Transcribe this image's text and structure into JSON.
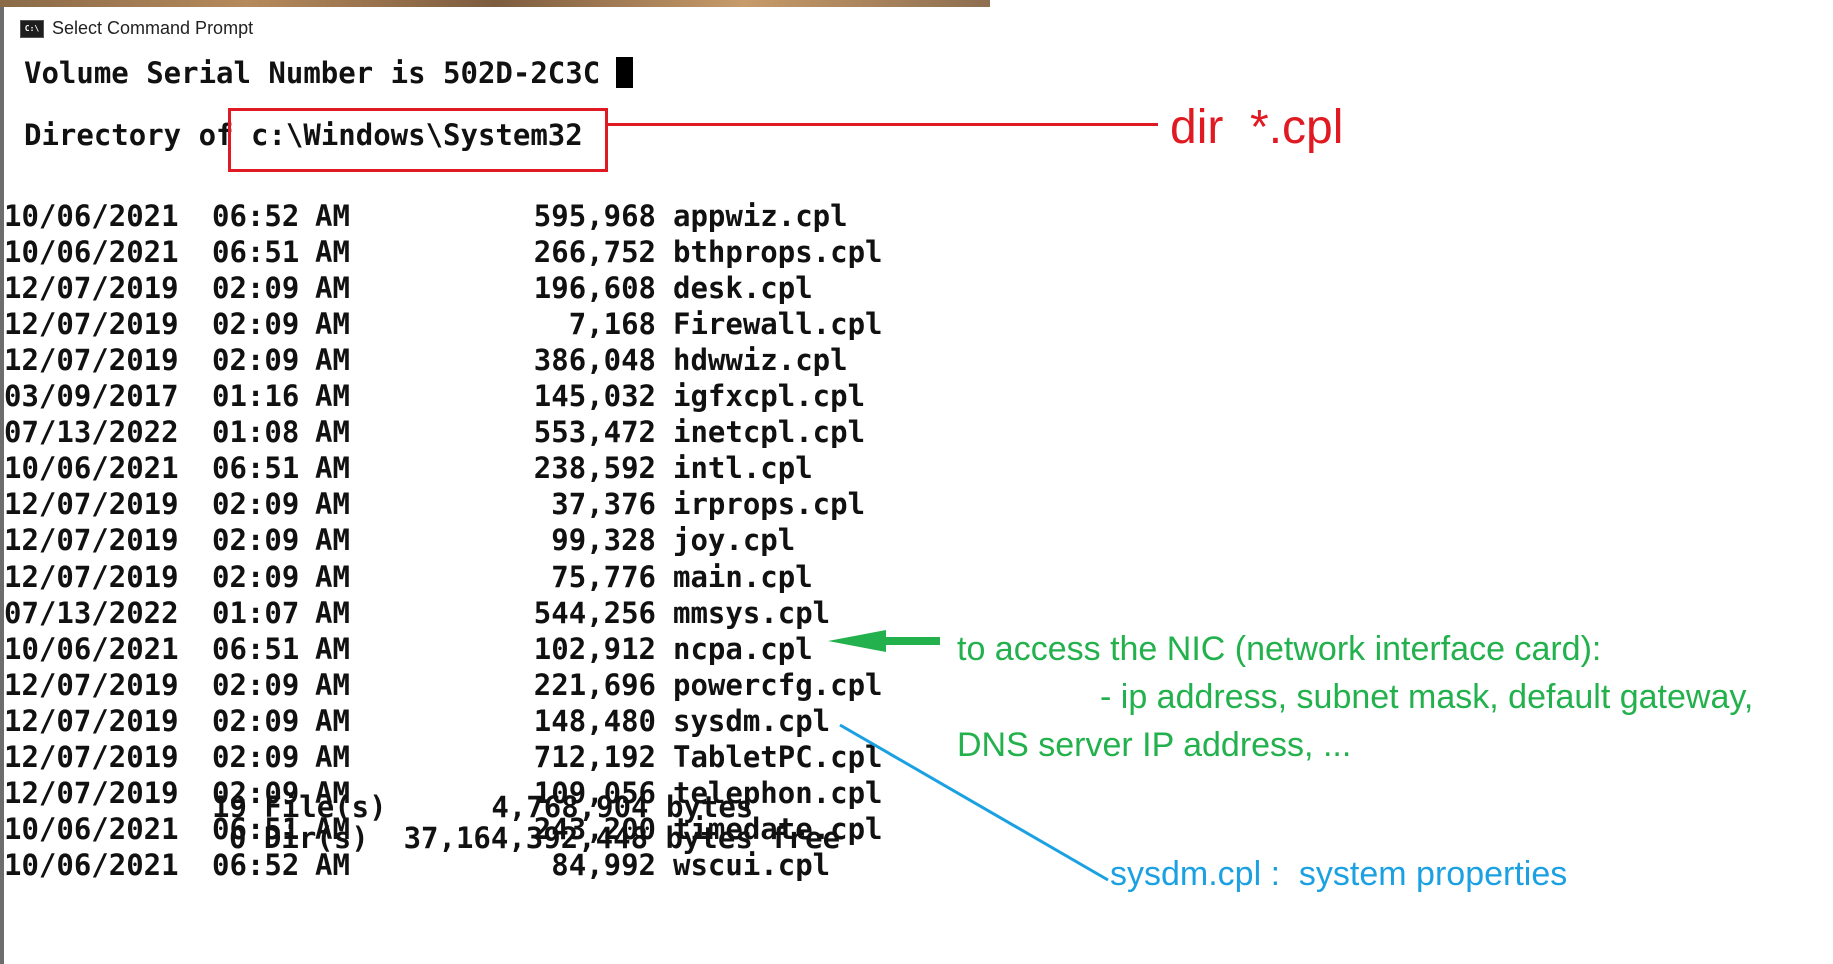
{
  "window": {
    "title": "Select Command Prompt",
    "icon": "cmd-icon"
  },
  "console": {
    "volume_line": "Volume Serial Number is 502D-2C3C",
    "directory_prefix": "Directory of ",
    "directory_path": "c:\\Windows\\System32",
    "files": [
      {
        "date": "10/06/2021",
        "time": "06:52",
        "ampm": "AM",
        "size": "595,968",
        "name": "appwiz.cpl"
      },
      {
        "date": "10/06/2021",
        "time": "06:51",
        "ampm": "AM",
        "size": "266,752",
        "name": "bthprops.cpl"
      },
      {
        "date": "12/07/2019",
        "time": "02:09",
        "ampm": "AM",
        "size": "196,608",
        "name": "desk.cpl"
      },
      {
        "date": "12/07/2019",
        "time": "02:09",
        "ampm": "AM",
        "size": "7,168",
        "name": "Firewall.cpl"
      },
      {
        "date": "12/07/2019",
        "time": "02:09",
        "ampm": "AM",
        "size": "386,048",
        "name": "hdwwiz.cpl"
      },
      {
        "date": "03/09/2017",
        "time": "01:16",
        "ampm": "AM",
        "size": "145,032",
        "name": "igfxcpl.cpl"
      },
      {
        "date": "07/13/2022",
        "time": "01:08",
        "ampm": "AM",
        "size": "553,472",
        "name": "inetcpl.cpl"
      },
      {
        "date": "10/06/2021",
        "time": "06:51",
        "ampm": "AM",
        "size": "238,592",
        "name": "intl.cpl"
      },
      {
        "date": "12/07/2019",
        "time": "02:09",
        "ampm": "AM",
        "size": "37,376",
        "name": "irprops.cpl"
      },
      {
        "date": "12/07/2019",
        "time": "02:09",
        "ampm": "AM",
        "size": "99,328",
        "name": "joy.cpl"
      },
      {
        "date": "12/07/2019",
        "time": "02:09",
        "ampm": "AM",
        "size": "75,776",
        "name": "main.cpl"
      },
      {
        "date": "07/13/2022",
        "time": "01:07",
        "ampm": "AM",
        "size": "544,256",
        "name": "mmsys.cpl"
      },
      {
        "date": "10/06/2021",
        "time": "06:51",
        "ampm": "AM",
        "size": "102,912",
        "name": "ncpa.cpl"
      },
      {
        "date": "12/07/2019",
        "time": "02:09",
        "ampm": "AM",
        "size": "221,696",
        "name": "powercfg.cpl"
      },
      {
        "date": "12/07/2019",
        "time": "02:09",
        "ampm": "AM",
        "size": "148,480",
        "name": "sysdm.cpl"
      },
      {
        "date": "12/07/2019",
        "time": "02:09",
        "ampm": "AM",
        "size": "712,192",
        "name": "TabletPC.cpl"
      },
      {
        "date": "12/07/2019",
        "time": "02:09",
        "ampm": "AM",
        "size": "109,056",
        "name": "telephon.cpl"
      },
      {
        "date": "10/06/2021",
        "time": "06:51",
        "ampm": "AM",
        "size": "243,200",
        "name": "timedate.cpl"
      },
      {
        "date": "10/06/2021",
        "time": "06:52",
        "ampm": "AM",
        "size": "84,992",
        "name": "wscui.cpl"
      }
    ],
    "summary_files": "19 File(s)      4,768,904 bytes",
    "summary_dirs": "0 Dir(s)  37,164,392,448 bytes free"
  },
  "annotations": {
    "command": "dir  *.cpl",
    "ncpa_note_line1": "to access the NIC (network interface card):",
    "ncpa_note_line2": "- ip address, subnet mask, default gateway,",
    "ncpa_note_line3": "DNS server IP address, ...",
    "sysdm_note": "sysdm.cpl :  system properties"
  },
  "colors": {
    "red_annotation": "#e01a22",
    "green_annotation": "#22b14c",
    "blue_annotation": "#1ba1e2",
    "console_text": "#111111",
    "background": "#ffffff"
  }
}
